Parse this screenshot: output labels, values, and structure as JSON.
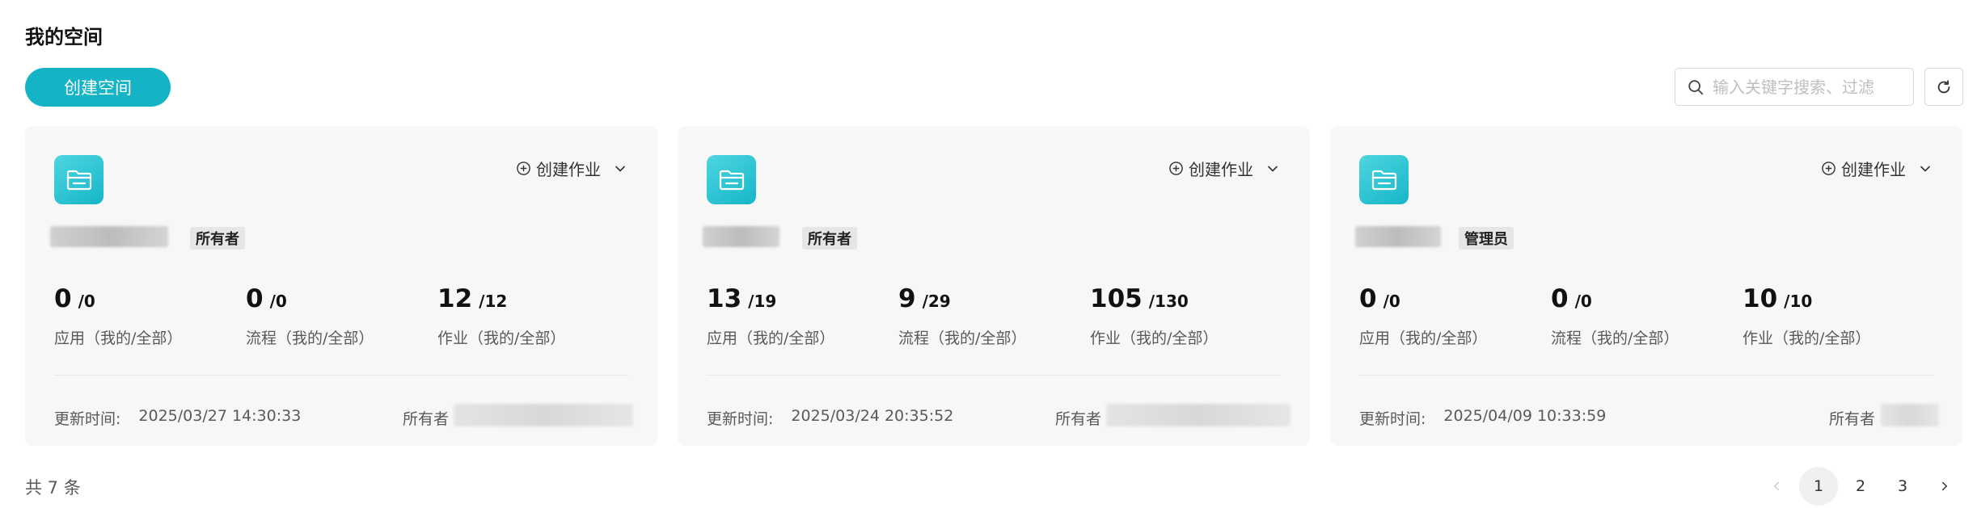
{
  "header": {
    "title": "我的空间"
  },
  "toolbar": {
    "create_label": "创建空间",
    "search_placeholder": "输入关键字搜索、过滤"
  },
  "cards": [
    {
      "create_job_label": "创建作业",
      "role": "所有者",
      "stats": [
        {
          "mine": "0",
          "total": "/0",
          "label": "应用（我的/全部）"
        },
        {
          "mine": "0",
          "total": "/0",
          "label": "流程（我的/全部）"
        },
        {
          "mine": "12",
          "total": "/12",
          "label": "作业（我的/全部）"
        }
      ],
      "updated_label": "更新时间:",
      "updated_value": "2025/03/27 14:30:33",
      "owner_label": "所有者"
    },
    {
      "create_job_label": "创建作业",
      "role": "所有者",
      "stats": [
        {
          "mine": "13",
          "total": "/19",
          "label": "应用（我的/全部）"
        },
        {
          "mine": "9",
          "total": "/29",
          "label": "流程（我的/全部）"
        },
        {
          "mine": "105",
          "total": "/130",
          "label": "作业（我的/全部）"
        }
      ],
      "updated_label": "更新时间:",
      "updated_value": "2025/03/24 20:35:52",
      "owner_label": "所有者"
    },
    {
      "create_job_label": "创建作业",
      "role": "管理员",
      "stats": [
        {
          "mine": "0",
          "total": "/0",
          "label": "应用（我的/全部）"
        },
        {
          "mine": "0",
          "total": "/0",
          "label": "流程（我的/全部）"
        },
        {
          "mine": "10",
          "total": "/10",
          "label": "作业（我的/全部）"
        }
      ],
      "updated_label": "更新时间:",
      "updated_value": "2025/04/09 10:33:59",
      "owner_label": "所有者"
    }
  ],
  "footer": {
    "total_text": "共 7 条",
    "pages": [
      "1",
      "2",
      "3"
    ],
    "current_page": "1"
  },
  "icons": {
    "search": "search-icon",
    "refresh": "refresh-icon",
    "folder": "folder-icon",
    "plus_circle": "plus-circle-icon",
    "chevron_down": "chevron-down-icon",
    "chevron_left": "chevron-left-icon",
    "chevron_right": "chevron-right-icon"
  },
  "colors": {
    "accent": "#14b3c6"
  }
}
